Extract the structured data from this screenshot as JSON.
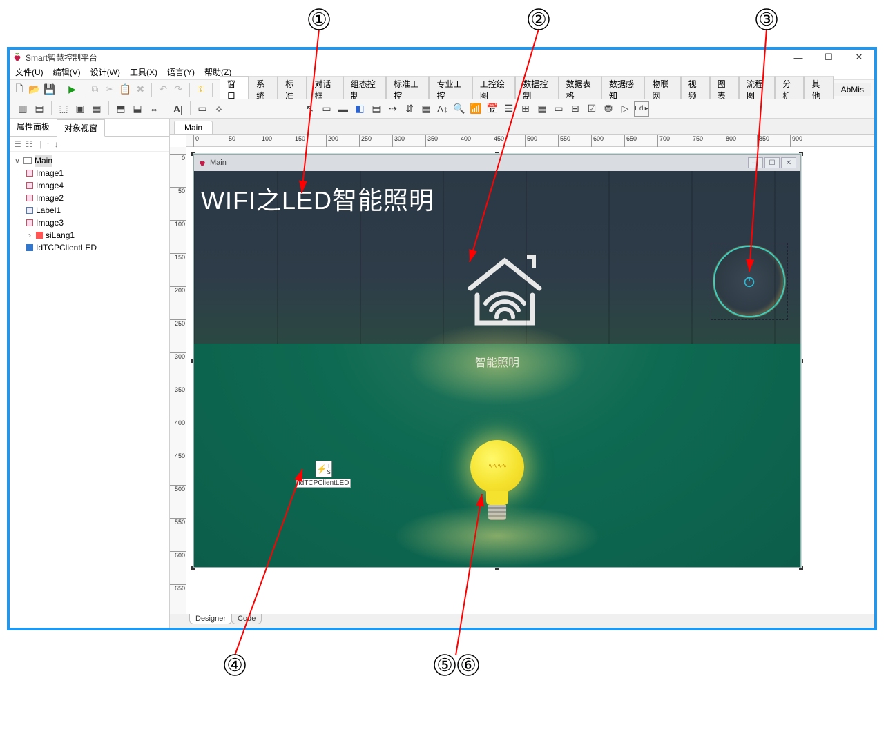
{
  "app": {
    "title": "Smart智慧控制平台"
  },
  "window_buttons": {
    "min": "—",
    "max": "☐",
    "close": "✕"
  },
  "menu": [
    "文件(U)",
    "编辑(V)",
    "设计(W)",
    "工具(X)",
    "语言(Y)",
    "帮助(Z)"
  ],
  "component_tabs": [
    "窗口",
    "系统",
    "标准",
    "对话框",
    "组态控制",
    "标准工控",
    "专业工控",
    "工控绘图",
    "数据控制",
    "数据表格",
    "数据感知",
    "物联网",
    "视频",
    "图表",
    "流程图",
    "分析",
    "其他",
    "AbMis"
  ],
  "side_tabs": {
    "prop": "属性面板",
    "obj": "对象视窗"
  },
  "tree": {
    "root": "Main",
    "children": [
      "Image1",
      "Image4",
      "Image2",
      "Label1",
      "Image3",
      "siLang1",
      "IdTCPClientLED"
    ]
  },
  "doc_tab": "Main",
  "ruler_h": [
    "0",
    "50",
    "100",
    "150",
    "200",
    "250",
    "300",
    "350",
    "400",
    "450",
    "500",
    "550",
    "600",
    "650",
    "700",
    "750",
    "800",
    "850",
    "900"
  ],
  "ruler_v": [
    "0",
    "50",
    "100",
    "150",
    "200",
    "250",
    "300",
    "350",
    "400",
    "450",
    "500",
    "550",
    "600",
    "650"
  ],
  "form": {
    "title": "Main",
    "header_text": "WIFI之LED智能照明",
    "subtitle": "智能照明",
    "tcp_component_label": "IdTCPClientLED"
  },
  "bottom_tabs": {
    "designer": "Designer",
    "code": "Code"
  },
  "annotations": {
    "a1": "①",
    "a2": "②",
    "a3": "③",
    "a4": "④",
    "a5": "⑤",
    "a6": "⑥"
  }
}
